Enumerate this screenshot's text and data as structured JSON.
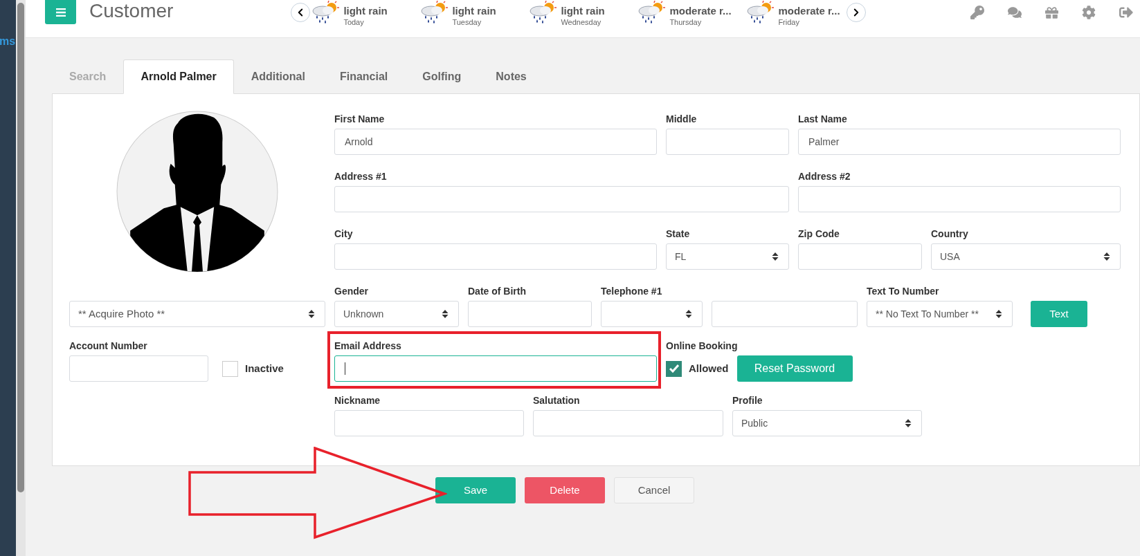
{
  "sidebar": {
    "text": "ms"
  },
  "header": {
    "title": "Customer"
  },
  "weather": [
    {
      "condition": "light rain",
      "day": "Today"
    },
    {
      "condition": "light rain",
      "day": "Tuesday"
    },
    {
      "condition": "light rain",
      "day": "Wednesday"
    },
    {
      "condition": "moderate r...",
      "day": "Thursday"
    },
    {
      "condition": "moderate r...",
      "day": "Friday"
    }
  ],
  "tabs": [
    {
      "label": "Search",
      "selected": false,
      "disabled": true
    },
    {
      "label": "Arnold Palmer",
      "selected": true,
      "disabled": false
    },
    {
      "label": "Additional",
      "selected": false,
      "disabled": false
    },
    {
      "label": "Financial",
      "selected": false,
      "disabled": false
    },
    {
      "label": "Golfing",
      "selected": false,
      "disabled": false
    },
    {
      "label": "Notes",
      "selected": false,
      "disabled": false
    }
  ],
  "photo_select": {
    "value": "** Acquire Photo **"
  },
  "account": {
    "label": "Account Number",
    "inactive": {
      "label": "Inactive",
      "checked": false
    }
  },
  "rows": [
    [
      {
        "kind": "input",
        "label": "First Name",
        "value": "Arnold",
        "focused": false
      },
      {
        "kind": "input",
        "label": "Middle",
        "focused": false
      },
      {
        "kind": "input",
        "label": "Last Name",
        "value": "Palmer",
        "focused": false
      }
    ],
    [
      {
        "kind": "input",
        "label": "Address #1",
        "focused": false
      },
      {
        "kind": "input",
        "label": "Address #2",
        "focused": false
      }
    ],
    [
      {
        "kind": "input",
        "label": "City",
        "focused": false
      },
      {
        "kind": "select",
        "label": "State",
        "value": "FL",
        "focused": false
      },
      {
        "kind": "input",
        "label": "Zip Code",
        "focused": false
      },
      {
        "kind": "select",
        "label": "Country",
        "value": "USA",
        "focused": false
      }
    ],
    [
      {
        "kind": "select",
        "label": "Gender",
        "value": "Unknown",
        "focused": false
      },
      {
        "kind": "input",
        "label": "Date of Birth",
        "focused": false
      },
      {
        "kind": "select",
        "label": "Telephone #1",
        "focused": false
      },
      {
        "kind": "input",
        "focused": false
      },
      {
        "kind": "select",
        "label": "Text To Number",
        "value": "** No Text To Number **",
        "focused": false
      },
      {
        "kind": "button",
        "value": "Text"
      }
    ],
    [
      {
        "kind": "input",
        "label": "Email Address",
        "focused": true
      },
      {
        "kind": "booking",
        "label": "Online Booking",
        "option": {
          "label": "Allowed",
          "checked": true
        },
        "button": "Reset Password"
      }
    ],
    [
      {
        "kind": "input",
        "label": "Nickname",
        "focused": false
      },
      {
        "kind": "input",
        "label": "Salutation",
        "focused": false
      },
      {
        "kind": "select",
        "label": "Profile",
        "value": "Public",
        "focused": false
      }
    ]
  ],
  "actions": [
    {
      "label": "Save",
      "kind": "primary"
    },
    {
      "label": "Delete",
      "kind": "danger"
    },
    {
      "label": "Cancel",
      "kind": "default"
    }
  ],
  "annotations": [
    {
      "kind": "frame"
    },
    {
      "kind": "arrow"
    }
  ]
}
